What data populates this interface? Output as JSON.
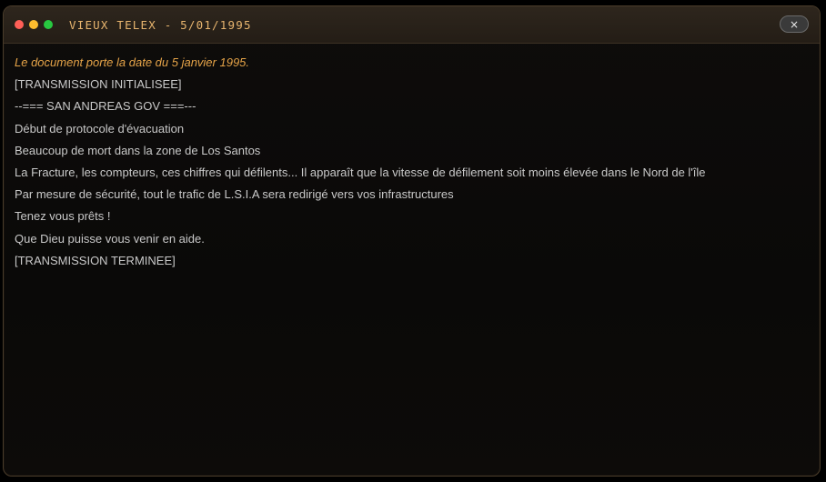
{
  "window": {
    "title": "VIEUX TELEX - 5/01/1995",
    "close_label": "×"
  },
  "colors": {
    "accent": "#e7b46e",
    "intro_text": "#e6a448",
    "body_text": "#c9c9c9",
    "traffic_red": "#ff5f57",
    "traffic_yellow": "#febc2e",
    "traffic_green": "#28c840"
  },
  "icons": {
    "close": "close-icon",
    "traffic": [
      "close-dot-icon",
      "minimize-dot-icon",
      "maximize-dot-icon"
    ]
  },
  "content": {
    "intro": "Le document porte la date du 5 janvier 1995.",
    "lines": [
      "[TRANSMISSION INITIALISEE]",
      "--=== SAN ANDREAS GOV ===---",
      "Début de protocole d'évacuation",
      "Beaucoup de mort dans la zone de Los Santos",
      "La Fracture, les compteurs, ces chiffres qui défilents... Il apparaît que la vitesse de défilement soit moins élevée dans le Nord de l'île",
      "Par mesure de sécurité, tout le trafic de L.S.I.A sera redirigé vers vos infrastructures",
      "Tenez vous prêts !",
      "Que Dieu puisse vous venir en aide.",
      "[TRANSMISSION TERMINEE]"
    ]
  }
}
